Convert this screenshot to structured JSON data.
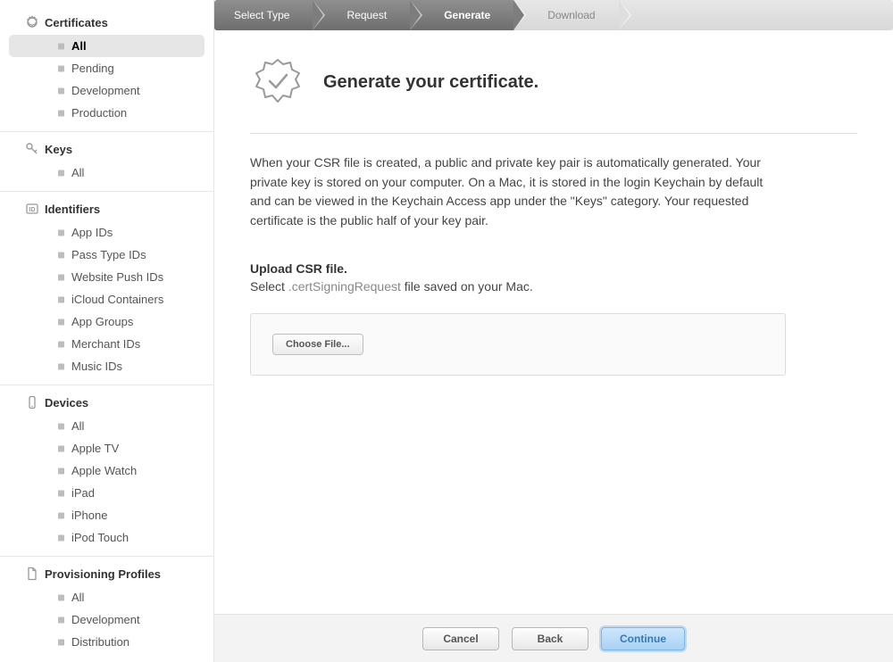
{
  "sidebar": {
    "sections": [
      {
        "title": "Certificates",
        "icon": "badge",
        "items": [
          "All",
          "Pending",
          "Development",
          "Production"
        ],
        "activeIndex": 0
      },
      {
        "title": "Keys",
        "icon": "key",
        "items": [
          "All"
        ]
      },
      {
        "title": "Identifiers",
        "icon": "id",
        "items": [
          "App IDs",
          "Pass Type IDs",
          "Website Push IDs",
          "iCloud Containers",
          "App Groups",
          "Merchant IDs",
          "Music IDs"
        ]
      },
      {
        "title": "Devices",
        "icon": "device",
        "items": [
          "All",
          "Apple TV",
          "Apple Watch",
          "iPad",
          "iPhone",
          "iPod Touch"
        ]
      },
      {
        "title": "Provisioning Profiles",
        "icon": "doc",
        "items": [
          "All",
          "Development",
          "Distribution"
        ]
      }
    ]
  },
  "steps": {
    "list": [
      "Select Type",
      "Request",
      "Generate",
      "Download"
    ],
    "currentIndex": 2
  },
  "main": {
    "title": "Generate your certificate.",
    "paragraph": "When your CSR file is created, a public and private key pair is automatically generated. Your private key is stored on your computer. On a Mac, it is stored in the login Keychain by default and can be viewed in the Keychain Access app under the \"Keys\" category. Your requested certificate is the public half of your key pair.",
    "uploadLabel": "Upload CSR file.",
    "uploadPrefix": "Select ",
    "uploadExt": ".certSigningRequest",
    "uploadSuffix": " file saved on your Mac.",
    "chooseFile": "Choose File..."
  },
  "footer": {
    "cancel": "Cancel",
    "back": "Back",
    "continue": "Continue"
  },
  "colors": {
    "primary": "#3a77b5"
  }
}
